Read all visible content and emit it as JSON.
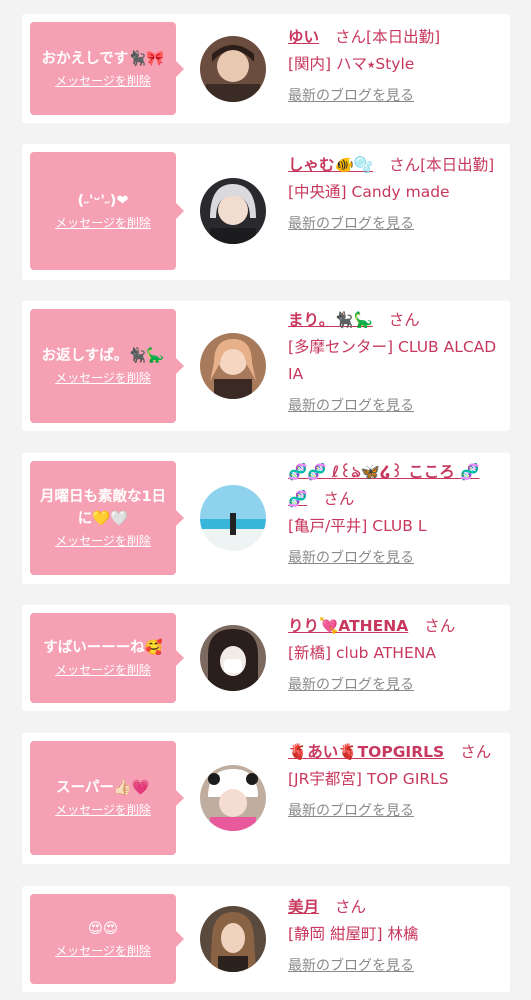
{
  "entries": [
    {
      "message": "おかえしです🐈‍⬛🎀",
      "delete_label": "メッセージを削除",
      "name": "ゆい",
      "honorific": "さん",
      "tag": "[本日出勤]",
      "shop": "[関内] ハマ⭑Style",
      "blog_label": "最新のブログを見る"
    },
    {
      "message": "(˶'ᵕ'˶)❤︎",
      "delete_label": "メッセージを削除",
      "name": "しゃむ🐠🫧",
      "honorific": "さん",
      "tag": "[本日出勤]",
      "shop": "[中央通] Candy made",
      "blog_label": "最新のブログを見る"
    },
    {
      "message": "お返しすぱ。🐈‍⬛🦕",
      "delete_label": "メッセージを削除",
      "name": "まり。🐈‍⬛🦕",
      "honorific": "さん",
      "tag": "",
      "shop": "[多摩センター] CLUB ALCADIA",
      "blog_label": "最新のブログを見る"
    },
    {
      "message": "月曜日も素敵な1日に💛🤍",
      "delete_label": "メッセージを削除",
      "name": "🧬🧬 ℓ꒰ঌ🦋໒꒱ こころ 🧬🧬",
      "honorific": "さん",
      "tag": "",
      "shop": "[亀戸/平井] CLUB L",
      "blog_label": "最新のブログを見る"
    },
    {
      "message": "すばいーーーね🥰",
      "delete_label": "メッセージを削除",
      "name": "りり💘ATHENA",
      "honorific": "さん",
      "tag": "",
      "shop": "[新橋] club ATHENA",
      "blog_label": "最新のブログを見る"
    },
    {
      "message": "スーパー👍🏻💗",
      "delete_label": "メッセージを削除",
      "name": "🫀あい🫀TOPGIRLS",
      "honorific": "さん",
      "tag": "",
      "shop": "[JR宇都宮] TOP GIRLS",
      "blog_label": "最新のブログを見る"
    },
    {
      "message": "😍😍",
      "delete_label": "メッセージを削除",
      "name": "美月",
      "honorific": "さん",
      "tag": "",
      "shop": "[静岡 紺屋町] 林檎",
      "blog_label": "最新のブログを見る"
    }
  ],
  "colors": {
    "background": "#f3f3f3",
    "bubble": "#f6a1b3",
    "name": "#c8385e",
    "link_gray": "#8a8a8a"
  }
}
